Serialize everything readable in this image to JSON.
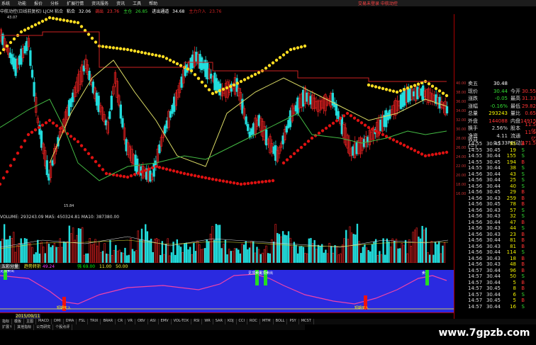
{
  "menu": [
    "系统",
    "功能",
    "报价",
    "分析",
    "扩展行情",
    "资讯服务",
    "资讯",
    "工具",
    "帮助"
  ],
  "top_right": "交易未登录  中航动控",
  "info_line": {
    "title": "中航动控(日线前复权) LJCM 粘合",
    "values": [
      {
        "label": "粘合",
        "value": "32.06",
        "color": "#ffffff"
      },
      {
        "label": "调出",
        "value": "23.76",
        "color": "#ff3333"
      },
      {
        "label": "主仓",
        "value": "26.85",
        "color": "#33dd33"
      },
      {
        "label": "进出通道",
        "value": "34.68",
        "color": "#ffffff"
      },
      {
        "label": "主力介入",
        "value": "23.76",
        "color": "#cc2222"
      }
    ]
  },
  "price_labels": {
    "high": "43.07",
    "low": "15.84"
  },
  "volume_header": "VOLUME: 293243.09  MA5: 450324.81  MA10: 387380.00",
  "indicator_header": {
    "name": "五彩分量",
    "label1": "趋势转折",
    "val1": "49.24",
    "label2": "强",
    "val2": "69.00",
    "label3": "11.00",
    "label4": "50.00"
  },
  "indicator_signals": [
    {
      "text": "见顶卖出",
      "color": "#ffffff"
    },
    {
      "text": "见顶卖出",
      "color": "#ffffff"
    },
    {
      "text": "见顶卖出",
      "color": "#ffffff"
    },
    {
      "text": "短期买入",
      "color": "#ffff00"
    },
    {
      "text": "短期买入",
      "color": "#ffff00"
    },
    {
      "text": "卖",
      "color": "#ffffff"
    }
  ],
  "date_label": "2015/09/11",
  "bottom_tabs_1": [
    "指标",
    "模板",
    "主图",
    "MACD",
    "DMI",
    "DMA",
    "FSL",
    "TRIX",
    "BRAR",
    "CR",
    "VR",
    "OBV",
    "ASI",
    "EMV",
    "VOL-TDX",
    "RSI",
    "WR",
    "SAR",
    "KDJ",
    "CCI",
    "ROC",
    "MTM",
    "BOLL",
    "PSY",
    "MCST"
  ],
  "bottom_tabs_2": [
    "扩展↑",
    "其他指标",
    "公司研究",
    "个股点评"
  ],
  "quote_panel": [
    {
      "l": "卖五",
      "v": "30.48",
      "vc": "#ffffff",
      "l2": "",
      "v2": ""
    },
    {
      "l": "现价",
      "v": "30.44",
      "vc": "#33dd33",
      "l2": "今开",
      "v2": "30.55"
    },
    {
      "l": "涨跌",
      "v": "-0.05",
      "vc": "#33dd33",
      "l2": "最高",
      "v2": "31.33"
    },
    {
      "l": "涨幅",
      "v": "-0.16%",
      "vc": "#33dd33",
      "l2": "最低",
      "v2": "29.82"
    },
    {
      "l": "总量",
      "v": "293243",
      "vc": "#ffff00",
      "l2": "量比",
      "v2": "0.65"
    },
    {
      "l": "外盘",
      "v": "144088",
      "vc": "#ff3333",
      "l2": "内盘",
      "v2": "149157"
    },
    {
      "l": "换手",
      "v": "2.56%",
      "vc": "#dddddd",
      "l2": "股本",
      "v2": "11.5亿"
    },
    {
      "l": "净资",
      "v": "4.11",
      "vc": "#dddddd",
      "l2": "流通",
      "v2": "11.5亿"
    },
    {
      "l": "收益(三)",
      "v": "0.133",
      "vc": "#dddddd",
      "l2": "PE(动)",
      "v2": "171.5"
    }
  ],
  "trades": [
    {
      "t": "14:55",
      "p": "30.45",
      "q": "85",
      "d": "B",
      "dc": "#ff3333"
    },
    {
      "t": "14:55",
      "p": "30.45",
      "q": "19",
      "d": "S",
      "dc": "#33dd33"
    },
    {
      "t": "14:55",
      "p": "30.44",
      "q": "155",
      "d": "S",
      "dc": "#33dd33"
    },
    {
      "t": "14:55",
      "p": "30.45",
      "q": "194",
      "d": "B",
      "dc": "#ff3333"
    },
    {
      "t": "14:55",
      "p": "30.44",
      "q": "38",
      "d": "S",
      "dc": "#33dd33"
    },
    {
      "t": "14:56",
      "p": "30.44",
      "q": "43",
      "d": "S",
      "dc": "#33dd33"
    },
    {
      "t": "14:56",
      "p": "30.44",
      "q": "25",
      "d": "S",
      "dc": "#33dd33"
    },
    {
      "t": "14:56",
      "p": "30.44",
      "q": "40",
      "d": "S",
      "dc": "#33dd33"
    },
    {
      "t": "14:56",
      "p": "30.45",
      "q": "29",
      "d": "B",
      "dc": "#ff3333"
    },
    {
      "t": "14:56",
      "p": "30.43",
      "q": "259",
      "d": "B",
      "dc": "#ff3333"
    },
    {
      "t": "14:56",
      "p": "30.45",
      "q": "78",
      "d": "B",
      "dc": "#ff3333"
    },
    {
      "t": "14:56",
      "p": "30.43",
      "q": "57",
      "d": "S",
      "dc": "#33dd33"
    },
    {
      "t": "14:56",
      "p": "30.43",
      "q": "32",
      "d": "S",
      "dc": "#33dd33"
    },
    {
      "t": "14:56",
      "p": "30.44",
      "q": "47",
      "d": "B",
      "dc": "#ff3333"
    },
    {
      "t": "14:56",
      "p": "30.43",
      "q": "44",
      "d": "S",
      "dc": "#33dd33"
    },
    {
      "t": "14:56",
      "p": "30.43",
      "q": "23",
      "d": "B",
      "dc": "#ff3333"
    },
    {
      "t": "14:56",
      "p": "30.44",
      "q": "81",
      "d": "B",
      "dc": "#ff3333"
    },
    {
      "t": "14:56",
      "p": "30.43",
      "q": "81",
      "d": "B",
      "dc": "#ff3333"
    },
    {
      "t": "14:56",
      "p": "30.44",
      "q": "114",
      "d": "S",
      "dc": "#33dd33"
    },
    {
      "t": "14:56",
      "p": "30.43",
      "q": "18",
      "d": "B",
      "dc": "#ff3333"
    },
    {
      "t": "14:56",
      "p": "30.43",
      "q": "48",
      "d": "B",
      "dc": "#ff3333"
    },
    {
      "t": "14:57",
      "p": "30.44",
      "q": "96",
      "d": "B",
      "dc": "#ff3333"
    },
    {
      "t": "14:57",
      "p": "30.44",
      "q": "50",
      "d": "S",
      "dc": "#33dd33"
    },
    {
      "t": "14:57",
      "p": "30.44",
      "q": "5",
      "d": "B",
      "dc": "#ff3333"
    },
    {
      "t": "14:57",
      "p": "30.45",
      "q": "8",
      "d": "B",
      "dc": "#ff3333"
    },
    {
      "t": "14:57",
      "p": "30.44",
      "q": "6",
      "d": "S",
      "dc": "#33dd33"
    },
    {
      "t": "14:57",
      "p": "30.45",
      "q": "5",
      "d": "B",
      "dc": "#ff3333"
    },
    {
      "t": "14:57",
      "p": "30.44",
      "q": "16",
      "d": "S",
      "dc": "#33dd33"
    }
  ],
  "axis_ticks": [
    "40.00",
    "38.00",
    "36.00",
    "34.00",
    "32.00",
    "30.00",
    "28.00",
    "26.00",
    "24.00",
    "22.00",
    "20.00",
    "18.00",
    "16.00"
  ],
  "watermark": "www.7gpzb.com"
}
